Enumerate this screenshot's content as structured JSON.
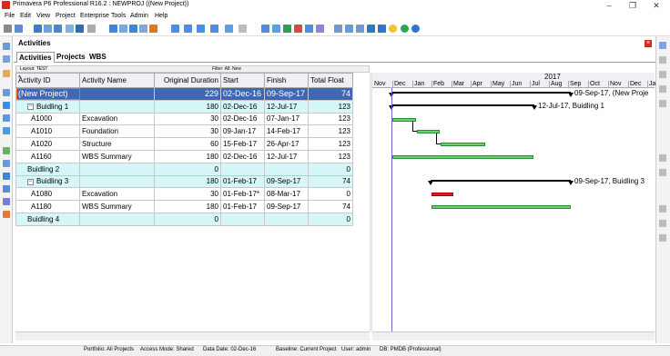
{
  "window": {
    "title": "Primavera P6 Professional R16.2 : NEWPROJ ((New Project))",
    "min": "–",
    "max": "❐",
    "close": "✕"
  },
  "menu": [
    "File",
    "Edit",
    "View",
    "Project",
    "Enterprise",
    "Tools",
    "Admin",
    "Help"
  ],
  "panel": {
    "title": "Activities",
    "close": "×"
  },
  "tabs": [
    "Activities",
    "Projects",
    "WBS"
  ],
  "layout_bar": {
    "layout": "Layout: TEST",
    "filter": "Filter: All: New"
  },
  "columns": [
    "Activity ID",
    "Activity Name",
    "Original Duration",
    "Start",
    "Finish",
    "Total Float"
  ],
  "rows": [
    {
      "type": "proj",
      "toggle": "",
      "id": "(New Project)",
      "name": "",
      "dur": "229",
      "start": "02-Dec-16",
      "finish": "09-Sep-17",
      "float": "74"
    },
    {
      "type": "wbs",
      "toggle": "−",
      "id": "Buidling 1",
      "name": "",
      "dur": "180",
      "start": "02-Dec-16",
      "finish": "12-Jul-17",
      "float": "123"
    },
    {
      "type": "act",
      "toggle": "",
      "id": "A1000",
      "name": "Excavation",
      "dur": "30",
      "start": "02-Dec-16",
      "finish": "07-Jan-17",
      "float": "123"
    },
    {
      "type": "act",
      "toggle": "",
      "id": "A1010",
      "name": "Foundation",
      "dur": "30",
      "start": "09-Jan-17",
      "finish": "14-Feb-17",
      "float": "123"
    },
    {
      "type": "act",
      "toggle": "",
      "id": "A1020",
      "name": "Structure",
      "dur": "60",
      "start": "15-Feb-17",
      "finish": "26-Apr-17",
      "float": "123"
    },
    {
      "type": "act",
      "toggle": "",
      "id": "A1160",
      "name": "WBS Summary",
      "dur": "180",
      "start": "02-Dec-16",
      "finish": "12-Jul-17",
      "float": "123"
    },
    {
      "type": "wbs",
      "toggle": "",
      "id": "Buidling 2",
      "name": "",
      "dur": "0",
      "start": "",
      "finish": "",
      "float": "0"
    },
    {
      "type": "wbs",
      "toggle": "−",
      "id": "Buidling 3",
      "name": "",
      "dur": "180",
      "start": "01-Feb-17",
      "finish": "09-Sep-17",
      "float": "74"
    },
    {
      "type": "act",
      "toggle": "",
      "id": "A1080",
      "name": "Excavation",
      "dur": "30",
      "start": "01-Feb-17*",
      "finish": "08-Mar-17",
      "float": "0"
    },
    {
      "type": "act",
      "toggle": "",
      "id": "A1180",
      "name": "WBS Summary",
      "dur": "180",
      "start": "01-Feb-17",
      "finish": "09-Sep-17",
      "float": "74"
    },
    {
      "type": "wbs",
      "toggle": "",
      "id": "Buidling 4",
      "name": "",
      "dur": "0",
      "start": "",
      "finish": "",
      "float": "0"
    }
  ],
  "gantt": {
    "year": "2017",
    "months": [
      "Nov",
      "Dec",
      "Jan",
      "Feb",
      "Mar",
      "Apr",
      "May",
      "Jun",
      "Jul",
      "Aug",
      "Sep",
      "Oct",
      "Nov",
      "Dec",
      "Ja"
    ],
    "labels": {
      "project": "09-Sep-17, (New Proje",
      "b1": "12-Jul-17, Buidling 1",
      "b3": "09-Sep-17, Buidling 3"
    },
    "colors": {
      "normal": "#66d36e",
      "critical": "#e31b1b",
      "summary": "#000000",
      "today": "#6a6acd"
    }
  },
  "status": {
    "portfolio": "Portfolio: All Projects",
    "access": "Access Mode: Shared",
    "data_date": "Data Date: 02-Dec-16",
    "baseline": "Baseline: Current Project",
    "user": "User: admin",
    "db": "DB: PMDB (Professional)"
  }
}
